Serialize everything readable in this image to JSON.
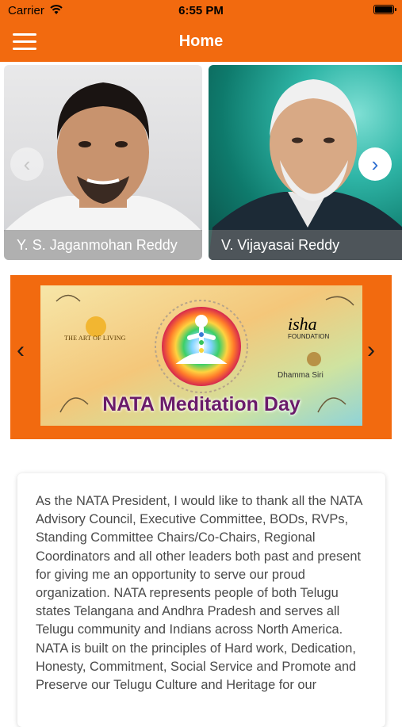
{
  "status_bar": {
    "carrier": "Carrier",
    "time": "6:55 PM"
  },
  "navbar": {
    "title": "Home",
    "menu_icon": "hamburger-menu-icon"
  },
  "leaders_carousel": {
    "items": [
      {
        "name": "Y. S. Jaganmohan Reddy"
      },
      {
        "name": "V. Vijayasai Reddy"
      }
    ],
    "prev_icon": "chevron-left-icon",
    "next_icon": "chevron-right-icon"
  },
  "event_banner": {
    "title": "NATA Meditation Day",
    "logo_left": "THE ART OF LIVING",
    "logo_right": "isha",
    "logo_right_sub": "FOUNDATION",
    "logo_bottom_right": "Dhamma Siri"
  },
  "message": {
    "text": "As the NATA President, I would like to thank all the NATA Advisory Council, Executive Committee, BODs, RVPs, Standing Committee Chairs/Co-Chairs, Regional Coordinators and all other leaders both past and present for giving me an opportunity to serve our proud organization. NATA represents people of both Telugu states Telangana and Andhra Pradesh and serves all Telugu community and Indians across North America. NATA is built on the principles of Hard work, Dedication, Honesty, Commitment, Social Service and Promote and Preserve our Telugu Culture and Heritage for our"
  },
  "colors": {
    "brand_orange": "#f26a0f",
    "text_gray": "#4a4a4a"
  }
}
